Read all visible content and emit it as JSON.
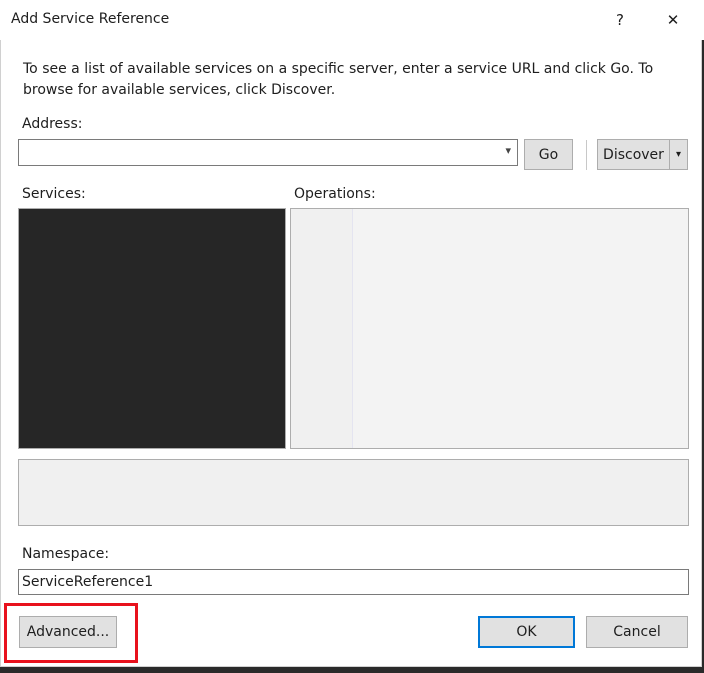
{
  "window": {
    "title": "Add Service Reference",
    "help_glyph": "?",
    "close_glyph": "✕"
  },
  "description": "To see a list of available services on a specific server, enter a service URL and click Go. To browse for available services, click Discover.",
  "address": {
    "label": "Address:",
    "value": "",
    "go_label": "Go",
    "discover_label": "Discover",
    "dropdown_glyph": "▾"
  },
  "services": {
    "label": "Services:"
  },
  "operations": {
    "label": "Operations:"
  },
  "namespace": {
    "label": "Namespace:",
    "value": "ServiceReference1"
  },
  "buttons": {
    "advanced": "Advanced...",
    "ok": "OK",
    "cancel": "Cancel"
  },
  "colors": {
    "accent": "#0078d7",
    "highlight": "#e8121d",
    "services_bg": "#262626"
  }
}
